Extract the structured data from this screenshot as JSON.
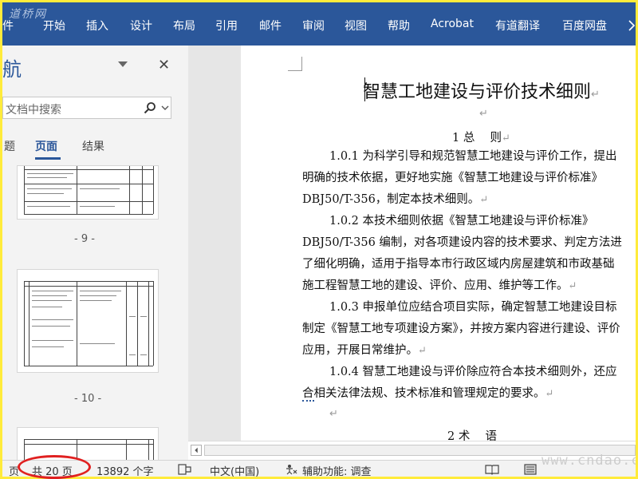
{
  "watermark_top": "道桥网",
  "menu": [
    "件",
    "开始",
    "插入",
    "设计",
    "布局",
    "引用",
    "邮件",
    "审阅",
    "视图",
    "帮助",
    "Acrobat",
    "有道翻译",
    "百度网盘"
  ],
  "nav": {
    "title": "航",
    "search_placeholder": "文档中搜索",
    "tabs": [
      "题",
      "页面",
      "结果"
    ],
    "thumb_labels": [
      "- 9 -",
      "- 10 -"
    ]
  },
  "document": {
    "title": "智慧工地建设与评价技术细则",
    "paragraph_mark": "↵",
    "section1": "1 总　 则",
    "para_1_0_1": [
      "1.0.1 为科学引导和规范智慧工地建设与评价工作，提出",
      "明确的技术依据，更好地实施《智慧工地建设与评价标准》",
      "DBJ50/T-356，制定本技术细则。"
    ],
    "para_1_0_2": [
      "1.0.2  本技术细则依据《智慧工地建设与评价标准》",
      "DBJ50/T-356 编制，对各项建设内容的技术要求、判定方法进",
      "了细化明确，适用于指导本市行政区域内房屋建筑和市政基础",
      "施工程智慧工地的建设、评价、应用、维护等工作。"
    ],
    "para_1_0_3": [
      "1.0.3 申报单位应结合项目实际，确定智慧工地建设目标",
      "制定《智慧工地专项建设方案》，并按方案内容进行建设、评价",
      "应用，开展日常维护。"
    ],
    "para_1_0_4": [
      "1.0.4  智慧工地建设与评价除应符合本技术细则外，还应",
      "合",
      "相关法律法规、技术标准和管理规定的要求。"
    ],
    "section2": "2 术　 语"
  },
  "status": {
    "page_prefix": "页",
    "page_count": "共 20 页",
    "word_count": "13892 个字",
    "language": "中文(中国)",
    "accessibility": "辅助功能: 调查"
  },
  "watermark_bottom": "www.cndao.com",
  "colors": {
    "ribbon": "#2b579a",
    "highlight_circle": "#e02020",
    "border": "#ffeb3b"
  }
}
